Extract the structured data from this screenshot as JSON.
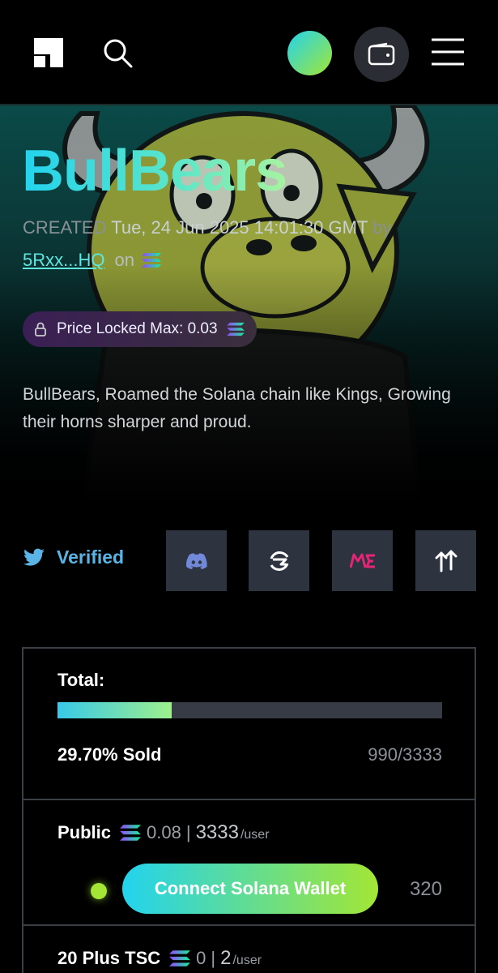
{
  "header": {
    "logo_icon": "brand-logo-icon",
    "search_icon": "search-icon",
    "wallet_icon": "wallet-icon",
    "menu_icon": "hamburger-menu-icon"
  },
  "collection": {
    "title": "BullBears",
    "created_label": "CREATED",
    "created_date": "Tue, 24 Jun 2025 14:01:30 GMT",
    "by_label": "by",
    "creator": "5Rxx...HQ",
    "on_label": "on",
    "price_locked": "Price Locked Max: 0.03",
    "description": "BullBears, Roamed the Solana chain like Kings, Growing their horns sharper and proud."
  },
  "social": {
    "verified_label": "Verified",
    "buttons": [
      "discord-icon",
      "exchange-icon",
      "magic-eden-icon",
      "tensor-icon"
    ]
  },
  "mint": {
    "total_label": "Total:",
    "progress": 0.297,
    "sold_text": "29.70% Sold",
    "count_text": "990/3333",
    "tiers": [
      {
        "name": "Public",
        "price": "0.08",
        "limit": "3333",
        "per": "/user"
      },
      {
        "name": "20 Plus TSC",
        "price": "0",
        "limit": "2",
        "per": "/user"
      }
    ],
    "connect_label": "Connect Solana Wallet",
    "remaining": "320"
  },
  "colors": {
    "accent_start": "#22d3ee",
    "accent_end": "#a3e635",
    "link": "#5ee6e0",
    "twitter": "#5ab4e6"
  }
}
